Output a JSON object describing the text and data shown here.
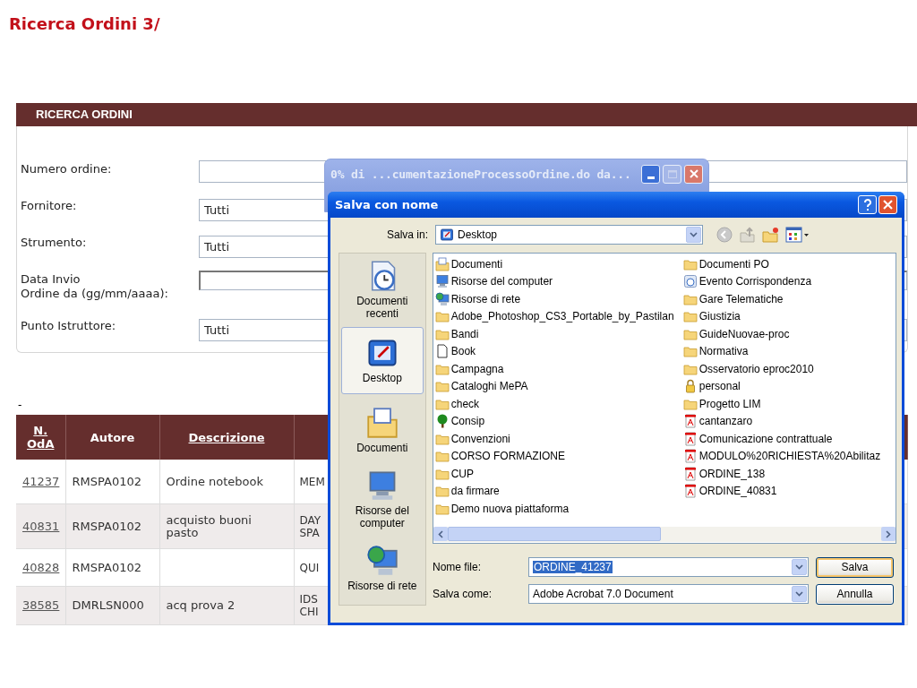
{
  "page_title": "Ricerca Ordini 3/",
  "search_panel": {
    "title": "RICERCA ORDINI",
    "fields": [
      {
        "label": "Numero ordine:",
        "kind": "text"
      },
      {
        "label": "Fornitore:",
        "kind": "select",
        "value": "Tutti"
      },
      {
        "label": "Strumento:",
        "kind": "select",
        "value": "Tutti"
      },
      {
        "label": "Data Invio\nOrdine da (gg/mm/aaaa):",
        "kind": "date"
      },
      {
        "label": "Punto Istruttore:",
        "kind": "select",
        "value": "Tutti"
      }
    ]
  },
  "separator_text": "-",
  "results_table": {
    "columns": [
      {
        "label": "N. OdA",
        "link": true
      },
      {
        "label": "Autore",
        "link": false
      },
      {
        "label": "Descrizione",
        "link": true
      }
    ],
    "rows": [
      {
        "n_oda": "41237",
        "autore": "RMSPA0102",
        "descrizione": "Ordine notebook",
        "column_4": "MEM"
      },
      {
        "n_oda": "40831",
        "autore": "RMSPA0102",
        "descrizione": "acquisto buoni pasto",
        "column_4": "DAY SPA"
      },
      {
        "n_oda": "40828",
        "autore": "RMSPA0102",
        "descrizione": "",
        "column_4": "QUI"
      },
      {
        "n_oda": "38585",
        "autore": "DMRLSN000",
        "descrizione": "acq prova 2",
        "column_4": "IDS CHI"
      }
    ]
  },
  "download_window": {
    "title": "0% di ...cumentazioneProcessoOrdine.do da..."
  },
  "save_dialog": {
    "title": "Salva con nome",
    "save_in": {
      "label": "Salva in:",
      "value": "Desktop"
    },
    "places": [
      {
        "label": "Documenti recenti",
        "kind": "recent",
        "selected": false
      },
      {
        "label": "Desktop",
        "kind": "desktop",
        "selected": true
      },
      {
        "label": "Documenti",
        "kind": "documents",
        "selected": false
      },
      {
        "label": "Risorse del computer",
        "kind": "computer",
        "selected": false
      },
      {
        "label": "Risorse di rete",
        "kind": "network",
        "selected": false
      }
    ],
    "files": [
      {
        "name": "Documenti",
        "kind": "documents"
      },
      {
        "name": "Risorse del computer",
        "kind": "computer"
      },
      {
        "name": "Risorse di rete",
        "kind": "network"
      },
      {
        "name": "Adobe_Photoshop_CS3_Portable_by_Pastilan",
        "kind": "folder"
      },
      {
        "name": "Bandi",
        "kind": "folder"
      },
      {
        "name": "Book",
        "kind": "file"
      },
      {
        "name": "Campagna",
        "kind": "folder"
      },
      {
        "name": "Cataloghi MePA",
        "kind": "folder"
      },
      {
        "name": "check",
        "kind": "folder"
      },
      {
        "name": "Consip",
        "kind": "tree"
      },
      {
        "name": "Convenzioni",
        "kind": "folder"
      },
      {
        "name": "CORSO FORMAZIONE",
        "kind": "folder"
      },
      {
        "name": "CUP",
        "kind": "folder"
      },
      {
        "name": "da firmare",
        "kind": "folder"
      },
      {
        "name": "Demo nuova piattaforma",
        "kind": "folder"
      },
      {
        "name": "Documenti PO",
        "kind": "folder"
      },
      {
        "name": "Evento Corrispondenza",
        "kind": "event"
      },
      {
        "name": "Gare Telematiche",
        "kind": "folder"
      },
      {
        "name": "Giustizia",
        "kind": "folder"
      },
      {
        "name": "GuideNuovae-proc",
        "kind": "folder"
      },
      {
        "name": "Normativa",
        "kind": "folder"
      },
      {
        "name": "Osservatorio eproc2010",
        "kind": "folder"
      },
      {
        "name": "personal",
        "kind": "lock"
      },
      {
        "name": "Progetto LIM",
        "kind": "folder"
      },
      {
        "name": "cantanzaro",
        "kind": "pdf"
      },
      {
        "name": "Comunicazione contrattuale",
        "kind": "pdf"
      },
      {
        "name": "MODULO%20RICHIESTA%20Abilitaz",
        "kind": "pdf"
      },
      {
        "name": "ORDINE_138",
        "kind": "pdf"
      },
      {
        "name": "ORDINE_40831",
        "kind": "pdf"
      }
    ],
    "file_name": {
      "label": "Nome file:",
      "value": "ORDINE_41237",
      "value_selected": true
    },
    "save_as": {
      "label": "Salva come:",
      "value": "Adobe Acrobat 7.0 Document"
    },
    "buttons": [
      {
        "label": "Salva",
        "default": true
      },
      {
        "label": "Annulla",
        "default": false
      }
    ]
  }
}
